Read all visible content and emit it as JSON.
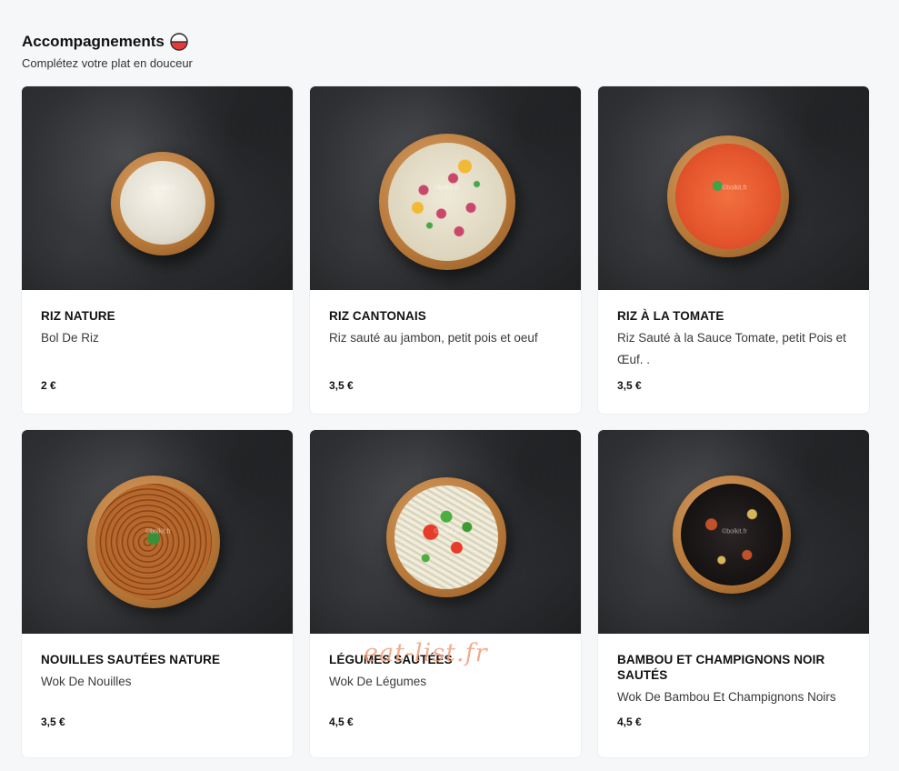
{
  "section": {
    "title": "Accompagnements",
    "subtitle": "Complétez votre plat en douceur",
    "title_icon": "rice-bowl-icon"
  },
  "products": [
    {
      "name": "RIZ NATURE",
      "description": "Bol De Riz",
      "price": "2 €",
      "image_icon": "plain-rice-bowl"
    },
    {
      "name": "RIZ CANTONAIS",
      "description": "Riz sauté au jambon, petit pois et oeuf",
      "price": "3,5 €",
      "image_icon": "cantonese-rice-bowl"
    },
    {
      "name": "RIZ À LA TOMATE",
      "description": "Riz Sauté à la Sauce Tomate, petit Pois et Œuf. .",
      "price": "3,5 €",
      "image_icon": "tomato-rice-bowl"
    },
    {
      "name": "NOUILLES SAUTÉES NATURE",
      "description": "Wok De Nouilles",
      "price": "3,5 €",
      "image_icon": "noodles-bowl"
    },
    {
      "name": "LÉGUMES SAUTÉES",
      "description": "Wok De Légumes",
      "price": "4,5 €",
      "image_icon": "vegetables-bowl"
    },
    {
      "name": "BAMBOU ET CHAMPIGNONS NOIR SAUTÉS",
      "description": "Wok De Bambou Et Champignons Noirs",
      "price": "4,5 €",
      "image_icon": "bamboo-mushroom-bowl"
    }
  ],
  "image_watermark": "©bolkit.fr",
  "page_watermark": "eat-list.fr",
  "colors": {
    "background": "#f5f7f9",
    "card": "#ffffff",
    "watermark": "#f0a07a",
    "bowl": "#b77838"
  }
}
